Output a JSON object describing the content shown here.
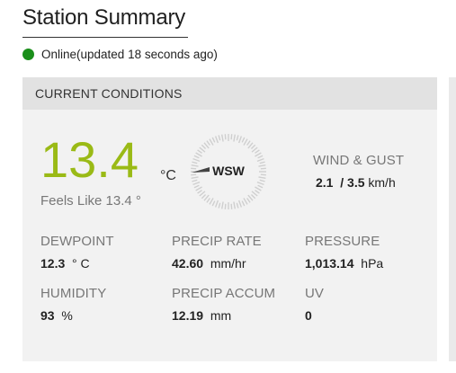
{
  "page": {
    "title": "Station Summary"
  },
  "status": {
    "text": "Online(updated 18 seconds ago)",
    "color": "#1a8f1a"
  },
  "card": {
    "header": "CURRENT CONDITIONS",
    "temperature": {
      "value": "13.4",
      "unit": "°C",
      "color": "#9aba16"
    },
    "feels_like": "Feels Like 13.4 °",
    "wind": {
      "direction": "WSW",
      "label": "WIND & GUST",
      "speed": "2.1",
      "gust": "/ 3.5",
      "unit": "km/h"
    },
    "dewpoint": {
      "label": "DEWPOINT",
      "value": "12.3",
      "unit": "° C"
    },
    "precip_rate": {
      "label": "PRECIP RATE",
      "value": "42.60",
      "unit": "mm/hr"
    },
    "pressure": {
      "label": "PRESSURE",
      "value": "1,013.14",
      "unit": "hPa"
    },
    "humidity": {
      "label": "HUMIDITY",
      "value": "93",
      "unit": "%"
    },
    "precip_accum": {
      "label": "PRECIP ACCUM",
      "value": "12.19",
      "unit": "mm"
    },
    "uv": {
      "label": "UV",
      "value": "0"
    }
  }
}
